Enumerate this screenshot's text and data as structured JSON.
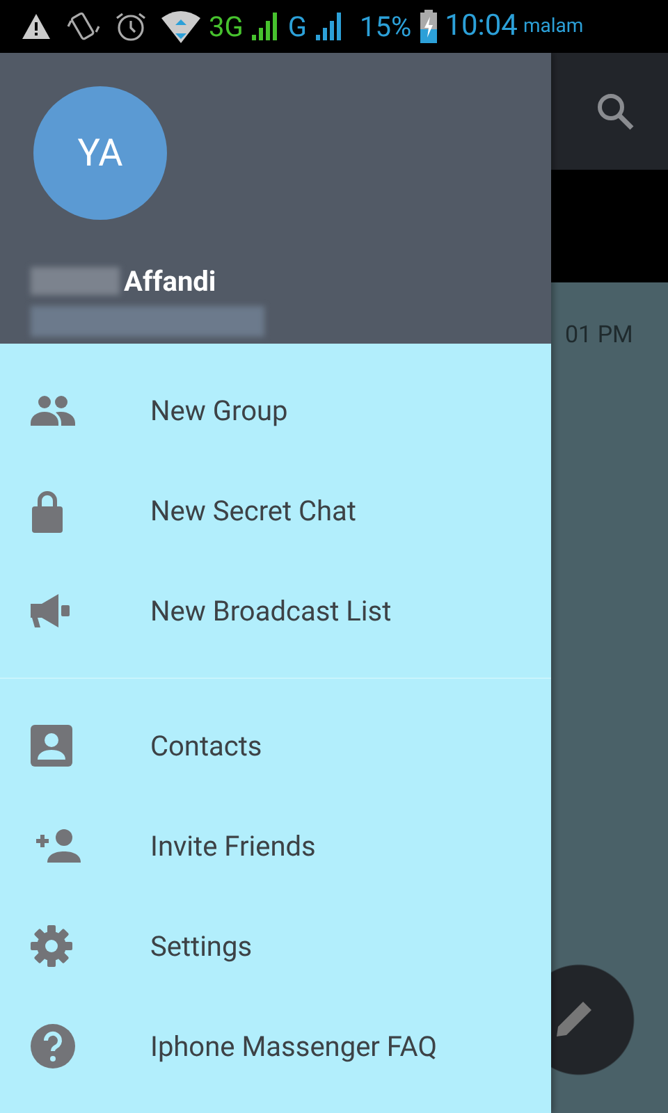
{
  "status_bar": {
    "network_1": "3G",
    "network_2": "G",
    "battery": "15%",
    "time": "10:04",
    "period": "malam"
  },
  "background_screen": {
    "message_time": "01 PM"
  },
  "drawer": {
    "avatar_initials": "YA",
    "user_name": "Affandi",
    "sections": [
      [
        {
          "label": "New Group"
        },
        {
          "label": "New Secret Chat"
        },
        {
          "label": "New Broadcast List"
        }
      ],
      [
        {
          "label": "Contacts"
        },
        {
          "label": "Invite Friends"
        },
        {
          "label": "Settings"
        },
        {
          "label": "Iphone Massenger FAQ"
        }
      ]
    ]
  }
}
